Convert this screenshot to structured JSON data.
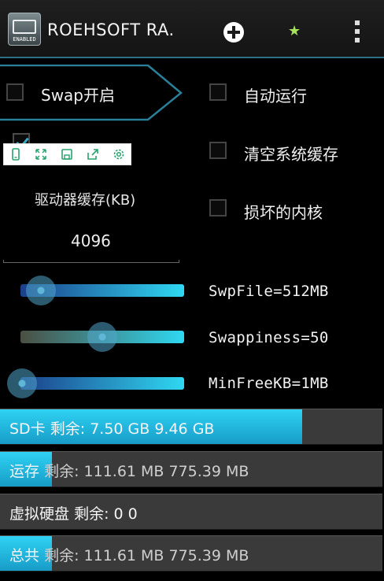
{
  "app": {
    "title": "ROEHSOFT RA.",
    "icon_name": "ram-chip-app-icon",
    "icon_text": "ENABLED"
  },
  "actions": {
    "add_icon": "plus-circle-icon",
    "favorite_icon": "star-icon",
    "overflow_icon": "overflow-menu-icon"
  },
  "options": {
    "swap": {
      "label": "Swap开启",
      "checked": false
    },
    "auto_run": {
      "label": "自动运行",
      "checked": false
    },
    "clear_cache": {
      "label": "清空系统缓存",
      "checked": false
    },
    "broken_kernel": {
      "label": "损坏的内核",
      "checked": false
    },
    "hidden_option": {
      "checked": true
    }
  },
  "drive_cache": {
    "label": "驱动器缓存(KB)",
    "value": "4096"
  },
  "sliders": [
    {
      "label": "SwpFile=512MB",
      "position": 0.12
    },
    {
      "label": "Swappiness=50",
      "position": 0.5
    },
    {
      "label": "MinFreeKB=1MB",
      "position": 0.0
    }
  ],
  "memory": [
    {
      "name": "SD卡",
      "free_label": "剩余:",
      "values": "7.50 GB 9.46 GB",
      "fill": 0.79
    },
    {
      "name": "运存",
      "free_label": "剩余:",
      "values": "111.61 MB 775.39 MB",
      "fill": 0.14
    },
    {
      "name": "虚拟硬盘",
      "free_label": "剩余:",
      "values": "0 0",
      "fill": 0.0
    },
    {
      "name": "总共",
      "free_label": "剩余:",
      "values": "111.61 MB 775.39 MB",
      "fill": 0.14
    }
  ],
  "colors": {
    "accent": "#2fd2f4",
    "bar_bg": "#3a3a3a"
  },
  "toolbar_icons": [
    "phone-icon",
    "fullscreen-icon",
    "save-icon",
    "share-icon",
    "settings-icon"
  ]
}
